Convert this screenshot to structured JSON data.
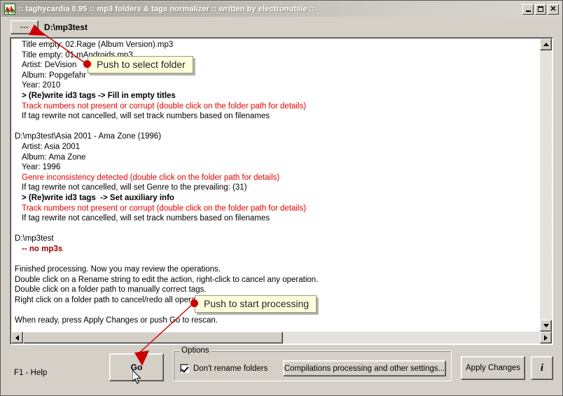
{
  "window": {
    "title": ":: taghycardia 0.95 :: mp3 folders & tags normalizer :: written by electronutsie ::",
    "icon": "ecg-waveform-icon",
    "controls": {
      "minimize": "_",
      "maximize": "□",
      "close": "✕"
    }
  },
  "path_bar": {
    "browse_label": "...",
    "path": "D:\\mp3test"
  },
  "log": {
    "lines": [
      {
        "text": "Title empty: 02.Rage (Album Version).mp3",
        "style": "indent"
      },
      {
        "text": "Title empty: 01.mAndroids.mp3",
        "style": "indent"
      },
      {
        "text": "Artist: DeVision",
        "style": "indent"
      },
      {
        "text": "Album: Popgefahr",
        "style": "indent"
      },
      {
        "text": "Year: 2010",
        "style": "indent"
      },
      {
        "text": "> (Re)write id3 tags -> Fill in empty titles",
        "style": "indent bold"
      },
      {
        "text": "Track numbers not present or corrupt (double click on the folder path for details)",
        "style": "indent red"
      },
      {
        "text": "If tag rewrite not cancelled, will set track numbers based on filenames",
        "style": "indent"
      },
      {
        "text": "",
        "style": "blank"
      },
      {
        "text": "D:\\mp3test\\Asia 2001 - Ama Zone (1996)",
        "style": "root"
      },
      {
        "text": "Artist: Asia 2001",
        "style": "indent"
      },
      {
        "text": "Album: Ama Zone",
        "style": "indent"
      },
      {
        "text": "Year: 1996",
        "style": "indent"
      },
      {
        "text": "Genre inconsistency detected (double click on the folder path for details)",
        "style": "indent red"
      },
      {
        "text": "If tag rewrite not cancelled, will set Genre to the prevailing: (31)",
        "style": "indent"
      },
      {
        "text": "> (Re)write id3 tags  -> Set auxiliary info",
        "style": "indent bold"
      },
      {
        "text": "Track numbers not present or corrupt (double click on the folder path for details)",
        "style": "indent red"
      },
      {
        "text": "If tag rewrite not cancelled, will set track numbers based on filenames",
        "style": "indent"
      },
      {
        "text": "",
        "style": "blank"
      },
      {
        "text": "D:\\mp3test",
        "style": "root"
      },
      {
        "text": "-- no mp3s",
        "style": "indent darkred"
      },
      {
        "text": "",
        "style": "blank"
      },
      {
        "text": "Finished processing. Now you may review the operations.",
        "style": "root"
      },
      {
        "text": "Double click on a Rename string to edit the action, right-click to cancel any operation.",
        "style": "root"
      },
      {
        "text": "Double click on a folder path to manually correct tags.",
        "style": "root"
      },
      {
        "text": "Right click on a folder path to cancel/redo all operations for the folder.",
        "style": "root"
      },
      {
        "text": "",
        "style": "blank"
      },
      {
        "text": "When ready, press Apply Changes or push Go to rescan.",
        "style": "root"
      }
    ]
  },
  "scrollbars": {
    "vertical_up": "scroll-up-arrow",
    "vertical_down": "scroll-down-arrow",
    "horizontal_left": "scroll-left-arrow",
    "horizontal_right": "scroll-right-arrow"
  },
  "bottom_bar": {
    "help_hint": "F1 - Help",
    "go_label": "Go",
    "options": {
      "group_title": "Options",
      "checkbox_label": "Don't rename folders",
      "checkbox_checked": true,
      "settings_button": "Compilations processing and other settings..."
    },
    "apply_label": "Apply Changes",
    "info_label": "i"
  },
  "annotations": [
    {
      "id": "callout-select-folder",
      "text": "Push to select folder"
    },
    {
      "id": "callout-start-processing",
      "text": "Push to start processing"
    }
  ],
  "colors": {
    "face": "#d4d0c8",
    "error_text": "#e00000",
    "warn_text": "#a00000",
    "callout_bg": "#ffffdd",
    "annotation_red": "#cc0000"
  }
}
